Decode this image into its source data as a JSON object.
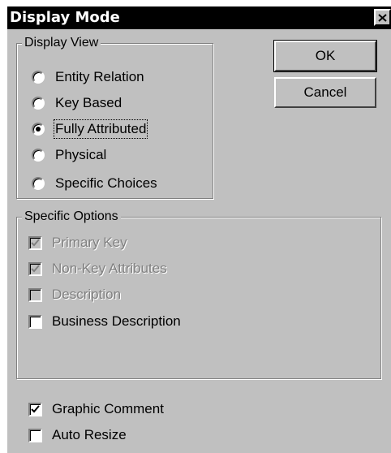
{
  "window": {
    "title": "Display Mode",
    "close_icon": "close-icon"
  },
  "display_view": {
    "title": "Display View",
    "options": [
      {
        "label": "Entity Relation",
        "selected": false
      },
      {
        "label": "Key Based",
        "selected": false
      },
      {
        "label": "Fully Attributed",
        "selected": true
      },
      {
        "label": "Physical",
        "selected": false
      },
      {
        "label": "Specific Choices",
        "selected": false
      }
    ]
  },
  "specific_options": {
    "title": "Specific Options",
    "items": [
      {
        "label": "Primary Key",
        "checked": true,
        "enabled": false
      },
      {
        "label": "Non-Key Attributes",
        "checked": true,
        "enabled": false
      },
      {
        "label": "Description",
        "checked": false,
        "enabled": false
      },
      {
        "label": "Business Description",
        "checked": false,
        "enabled": true
      }
    ]
  },
  "extra": {
    "items": [
      {
        "label": "Graphic Comment",
        "checked": true,
        "enabled": true
      },
      {
        "label": "Auto Resize",
        "checked": false,
        "enabled": true
      }
    ]
  },
  "buttons": {
    "ok": "OK",
    "cancel": "Cancel"
  },
  "colors": {
    "face": "#c0c0c0",
    "titlebar": "#000000",
    "disabled_text": "#808080"
  }
}
